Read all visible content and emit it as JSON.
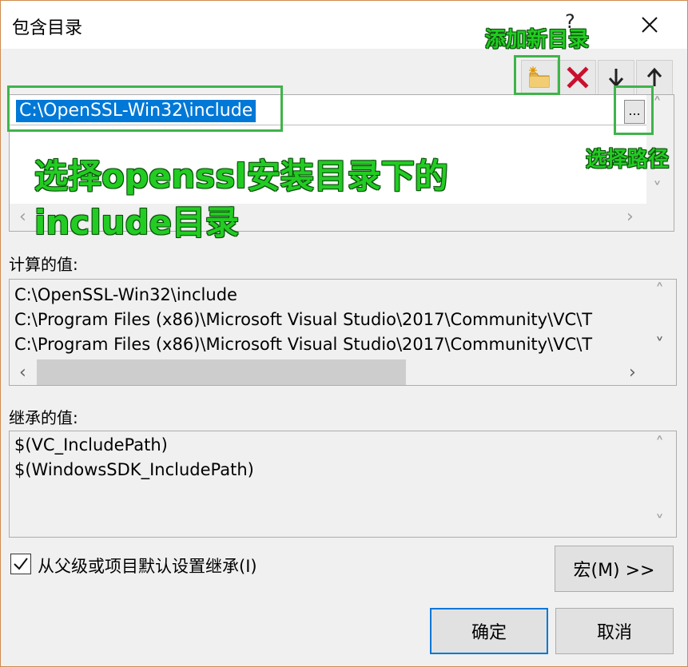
{
  "window": {
    "title": "包含目录",
    "help_label": "?"
  },
  "toolbar": {
    "add_tooltip_annotation": "添加新目录",
    "icons": [
      "new-folder-icon",
      "delete-x-icon",
      "move-down-icon",
      "move-up-icon"
    ]
  },
  "editor": {
    "current_value": "C:\\OpenSSL-Win32\\include",
    "browse_label": "...",
    "browse_annotation": "选择路径",
    "instruction_line1": "选择openssl安装目录下的",
    "instruction_line2": "include目录"
  },
  "evaluated": {
    "label": "计算的值:",
    "lines": [
      "C:\\OpenSSL-Win32\\include",
      "C:\\Program Files (x86)\\Microsoft Visual Studio\\2017\\Community\\VC\\T",
      "C:\\Program Files (x86)\\Microsoft Visual Studio\\2017\\Community\\VC\\T"
    ]
  },
  "inherited": {
    "label": "继承的值:",
    "lines": [
      "$(VC_IncludePath)",
      "$(WindowsSDK_IncludePath)"
    ]
  },
  "inherit_checkbox": {
    "label": "从父级或项目默认设置继承(I)",
    "checked": true
  },
  "buttons": {
    "macro": "宏(M) >>",
    "ok": "确定",
    "cancel": "取消"
  },
  "colors": {
    "selection": "#0078d7",
    "annotation_green": "#22cc22",
    "annotation_box": "#3fb44a",
    "delete_red": "#c8102e",
    "window_border": "#d08a4f"
  }
}
